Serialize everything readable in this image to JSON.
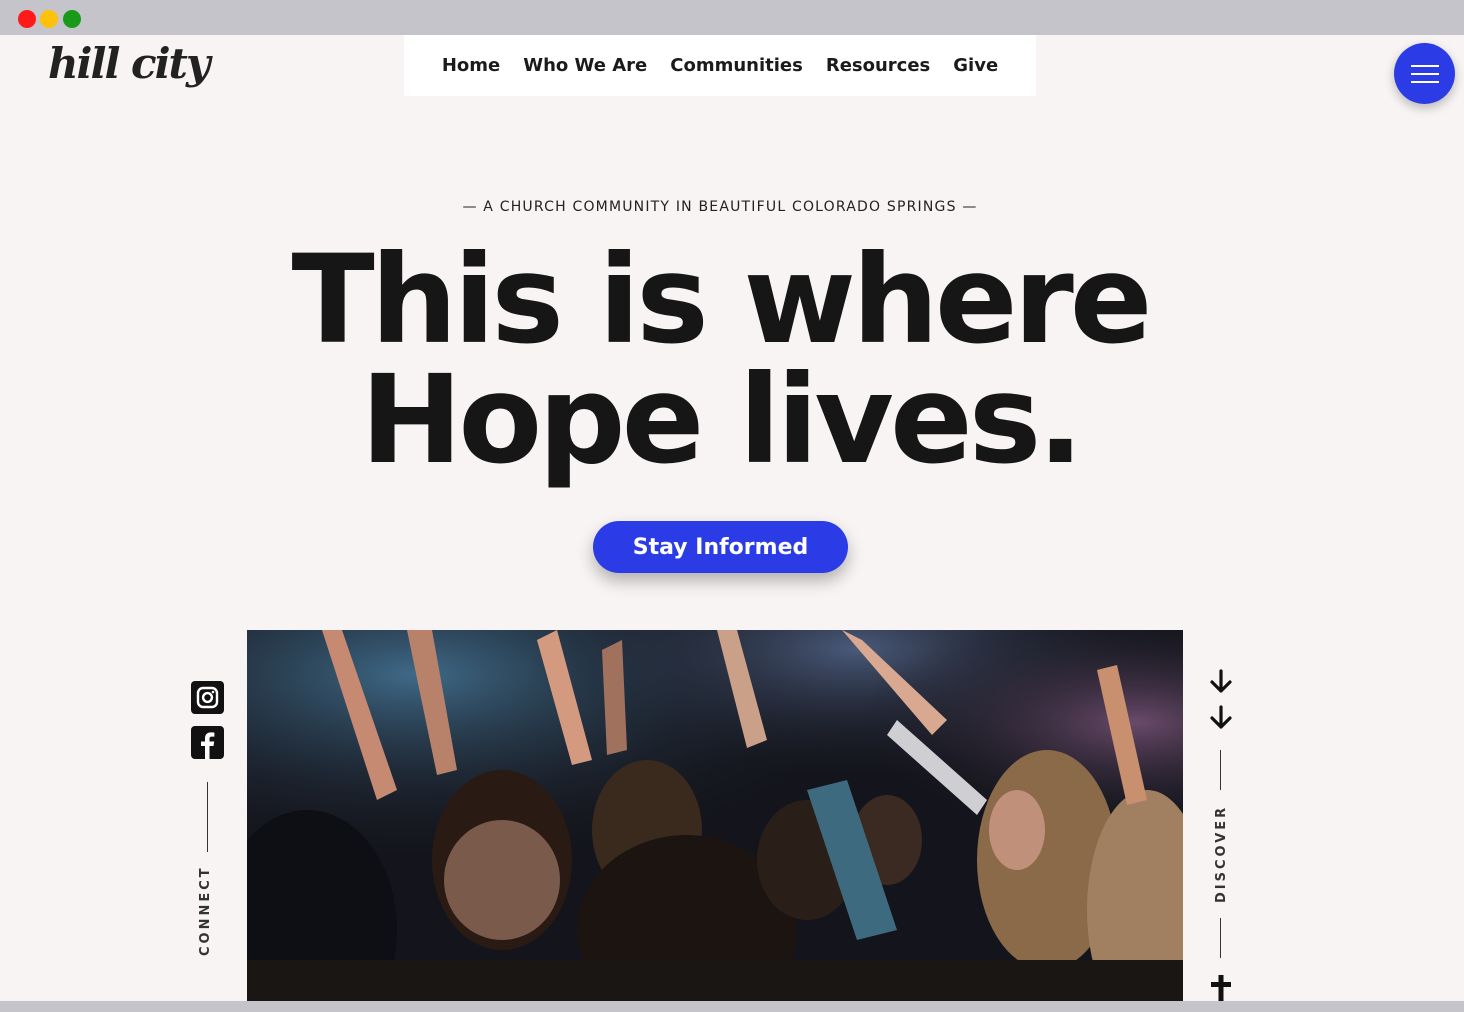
{
  "window": {
    "controls": [
      "close",
      "minimize",
      "maximize"
    ]
  },
  "brand": {
    "logo_text": "hill city"
  },
  "nav": {
    "items": [
      "Home",
      "Who We Are",
      "Communities",
      "Resources",
      "Give"
    ]
  },
  "menu": {
    "icon": "hamburger-icon",
    "color": "#2b3ce6"
  },
  "hero": {
    "tagline": "— A CHURCH COMMUNITY IN BEAUTIFUL COLORADO SPRINGS —",
    "headline_line1": "This is where",
    "headline_line2": "Hope lives.",
    "cta_label": "Stay Informed",
    "cta_color": "#2b3ce6"
  },
  "sidebar_left": {
    "label": "CONNECT",
    "icons": [
      "instagram-icon",
      "facebook-icon"
    ]
  },
  "sidebar_right": {
    "label": "DISCOVER",
    "icons": [
      "arrow-down-icon",
      "arrow-down-icon",
      "cross-icon"
    ]
  },
  "colors": {
    "background": "#f7f4f3",
    "text": "#161616",
    "accent": "#2b3ce6"
  }
}
